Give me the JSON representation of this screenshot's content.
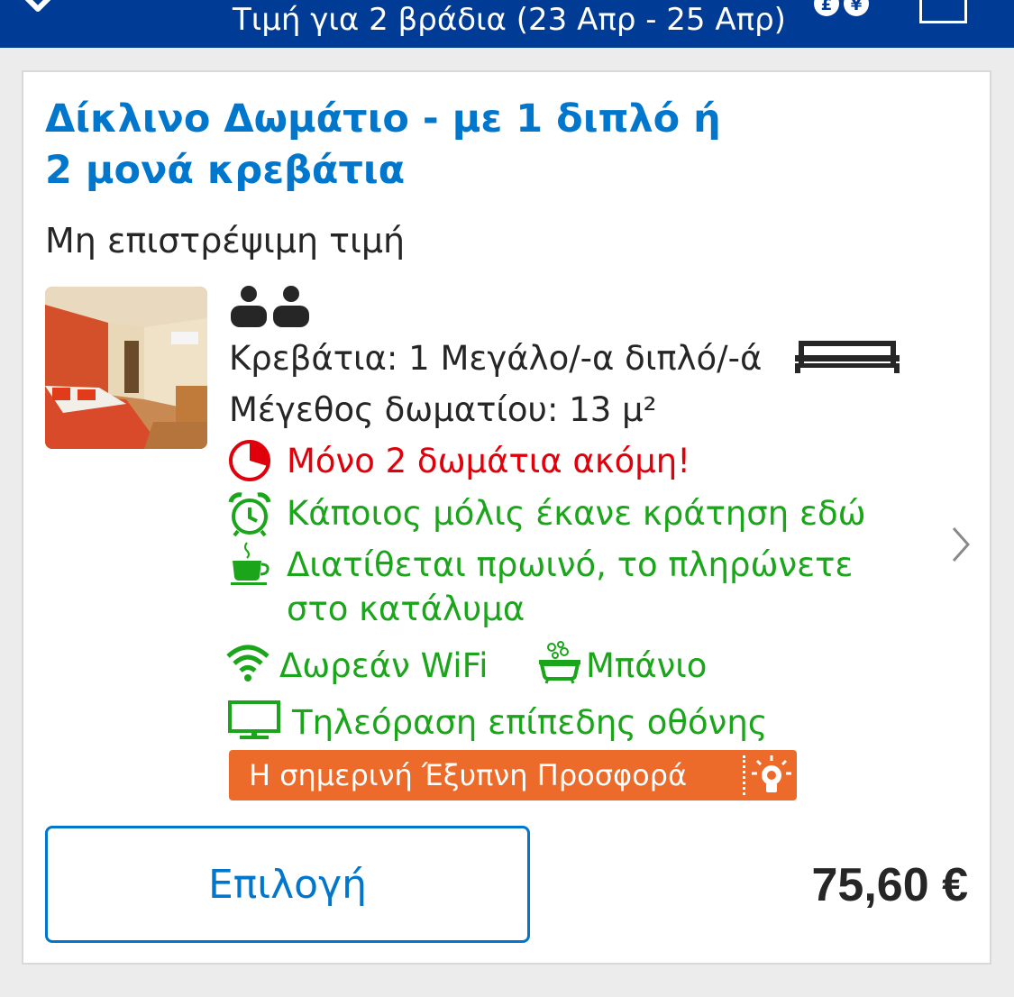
{
  "header": {
    "title": "Τιμή για 2 βράδια (23 Απρ - 25 Απρ)",
    "currency_symbols": [
      "£",
      "¥"
    ]
  },
  "room": {
    "title": "Δίκλινο Δωμάτιο - με 1 διπλό ή 2 μονά κρεβάτια",
    "refund_policy": "Μη επιστρέψιμη τιμή",
    "occupancy_guests": 2,
    "beds": "Κρεβάτια: 1 Μεγάλο/-α διπλό/-ά",
    "size_label": "Μέγεθος δωματίου: 13 μ²",
    "scarcity": "Μόνο 2 δωμάτια ακόμη!",
    "recent_booking": "Κάποιος μόλις έκανε κράτηση εδώ",
    "breakfast_line1": "Διατίθεται πρωινό, το πληρώνετε",
    "breakfast_line2": "στο κατάλυμα",
    "wifi": "Δωρεάν WiFi",
    "bathroom": "Μπάνιο",
    "tv": "Τηλεόραση επίπεδης οθόνης",
    "smart_deal": "Η σημερινή Έξυπνη Προσφορά",
    "select_label": "Επιλογή",
    "price": "75,60 €"
  },
  "colors": {
    "header_bg": "#003b95",
    "link_blue": "#0077cc",
    "urgent_red": "#e0000b",
    "benefit_green": "#1aa51a",
    "deal_orange": "#ec6b2a"
  },
  "icons": [
    "back-icon",
    "currency-icon",
    "map-icon",
    "occupancy-icon",
    "double-bed-icon",
    "pie-clock-icon",
    "alarm-clock-icon",
    "coffee-cup-icon",
    "wifi-icon",
    "bathtub-icon",
    "tv-icon",
    "lightbulb-icon",
    "chevron-right-icon"
  ]
}
